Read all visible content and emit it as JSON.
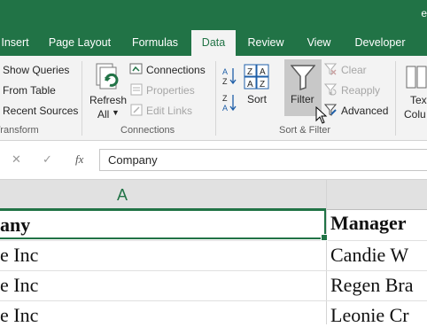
{
  "window": {
    "title_fragment": "e"
  },
  "tabs": [
    {
      "label": "Insert"
    },
    {
      "label": "Page Layout"
    },
    {
      "label": "Formulas"
    },
    {
      "label": "Data",
      "active": true
    },
    {
      "label": "Review"
    },
    {
      "label": "View"
    },
    {
      "label": "Developer"
    }
  ],
  "ribbon": {
    "get_transform": {
      "show_queries": "Show Queries",
      "from_table": "From Table",
      "recent_sources": "Recent Sources",
      "group_label": "Transform"
    },
    "connections": {
      "refresh_line1": "Refresh",
      "refresh_line2": "All",
      "connections": "Connections",
      "properties": "Properties",
      "edit_links": "Edit Links",
      "group_label": "Connections"
    },
    "sort_filter": {
      "sort": "Sort",
      "filter": "Filter",
      "clear": "Clear",
      "reapply": "Reapply",
      "advanced": "Advanced",
      "group_label": "Sort & Filter"
    },
    "data_tools": {
      "text_line1": "Text",
      "text_line2": "Colu"
    }
  },
  "formula_bar": {
    "cancel": "✕",
    "enter": "✓",
    "fx": "fx",
    "value": "Company"
  },
  "sheet": {
    "column_a": "A",
    "rows": [
      {
        "a": "any",
        "b": "Manager"
      },
      {
        "a": "e Inc",
        "b": "Candie W"
      },
      {
        "a": "e Inc",
        "b": "Regen Bra"
      },
      {
        "a": "e Inc",
        "b": "Leonie Cr"
      }
    ]
  },
  "colors": {
    "accent": "#217346",
    "ribbon_bg": "#f3f3f3",
    "pressed": "#c8c8c8"
  },
  "icons": [
    "connections-icon",
    "properties-icon",
    "edit-links-icon",
    "refresh-all-icon",
    "sort-az-icon",
    "sort-za-icon",
    "sort-icon",
    "filter-icon",
    "clear-filter-icon",
    "reapply-icon",
    "advanced-filter-icon",
    "mouse-cursor-icon"
  ]
}
